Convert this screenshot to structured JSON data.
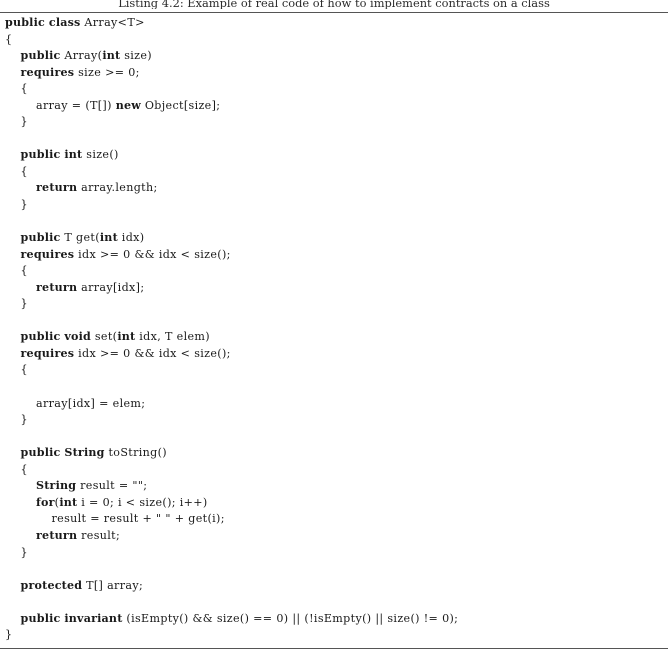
{
  "caption": {
    "text": "Listing 4.2: Example of real code of how to implement contracts on a class"
  },
  "code": {
    "language": "Java-like contract language",
    "lines": [
      "public class Array<T>",
      "{",
      "    public Array(int size)",
      "    requires size >= 0;",
      "    {",
      "        array = (T[]) new Object[size];",
      "    }",
      "",
      "    public int size()",
      "    {",
      "        return array.length;",
      "    }",
      "",
      "    public T get(int idx)",
      "    requires idx >= 0 && idx < size();",
      "    {",
      "        return array[idx];",
      "    }",
      "",
      "    public void set(int idx, T elem)",
      "    requires idx >= 0 && idx < size();",
      "    {",
      "",
      "        array[idx] = elem;",
      "    }",
      "",
      "    public String toString()",
      "    {",
      "        String result = \"\";",
      "        for(int i = 0; i < size(); i++)",
      "            result = result + \" \" + get(i);",
      "        return result;",
      "    }",
      "",
      "    protected T[] array;",
      "",
      "    public invariant (isEmpty() && size() == 0) || (!isEmpty() || size() != 0);",
      "}"
    ],
    "keywords": [
      "public",
      "class",
      "int",
      "new",
      "requires",
      "return",
      "void",
      "String",
      "for",
      "protected",
      "invariant",
      "T"
    ]
  },
  "colors": {
    "page_background": "#ffffff",
    "text": "#1a1a1a",
    "caption_text": "#2b2b2b",
    "rule": "#555555"
  }
}
